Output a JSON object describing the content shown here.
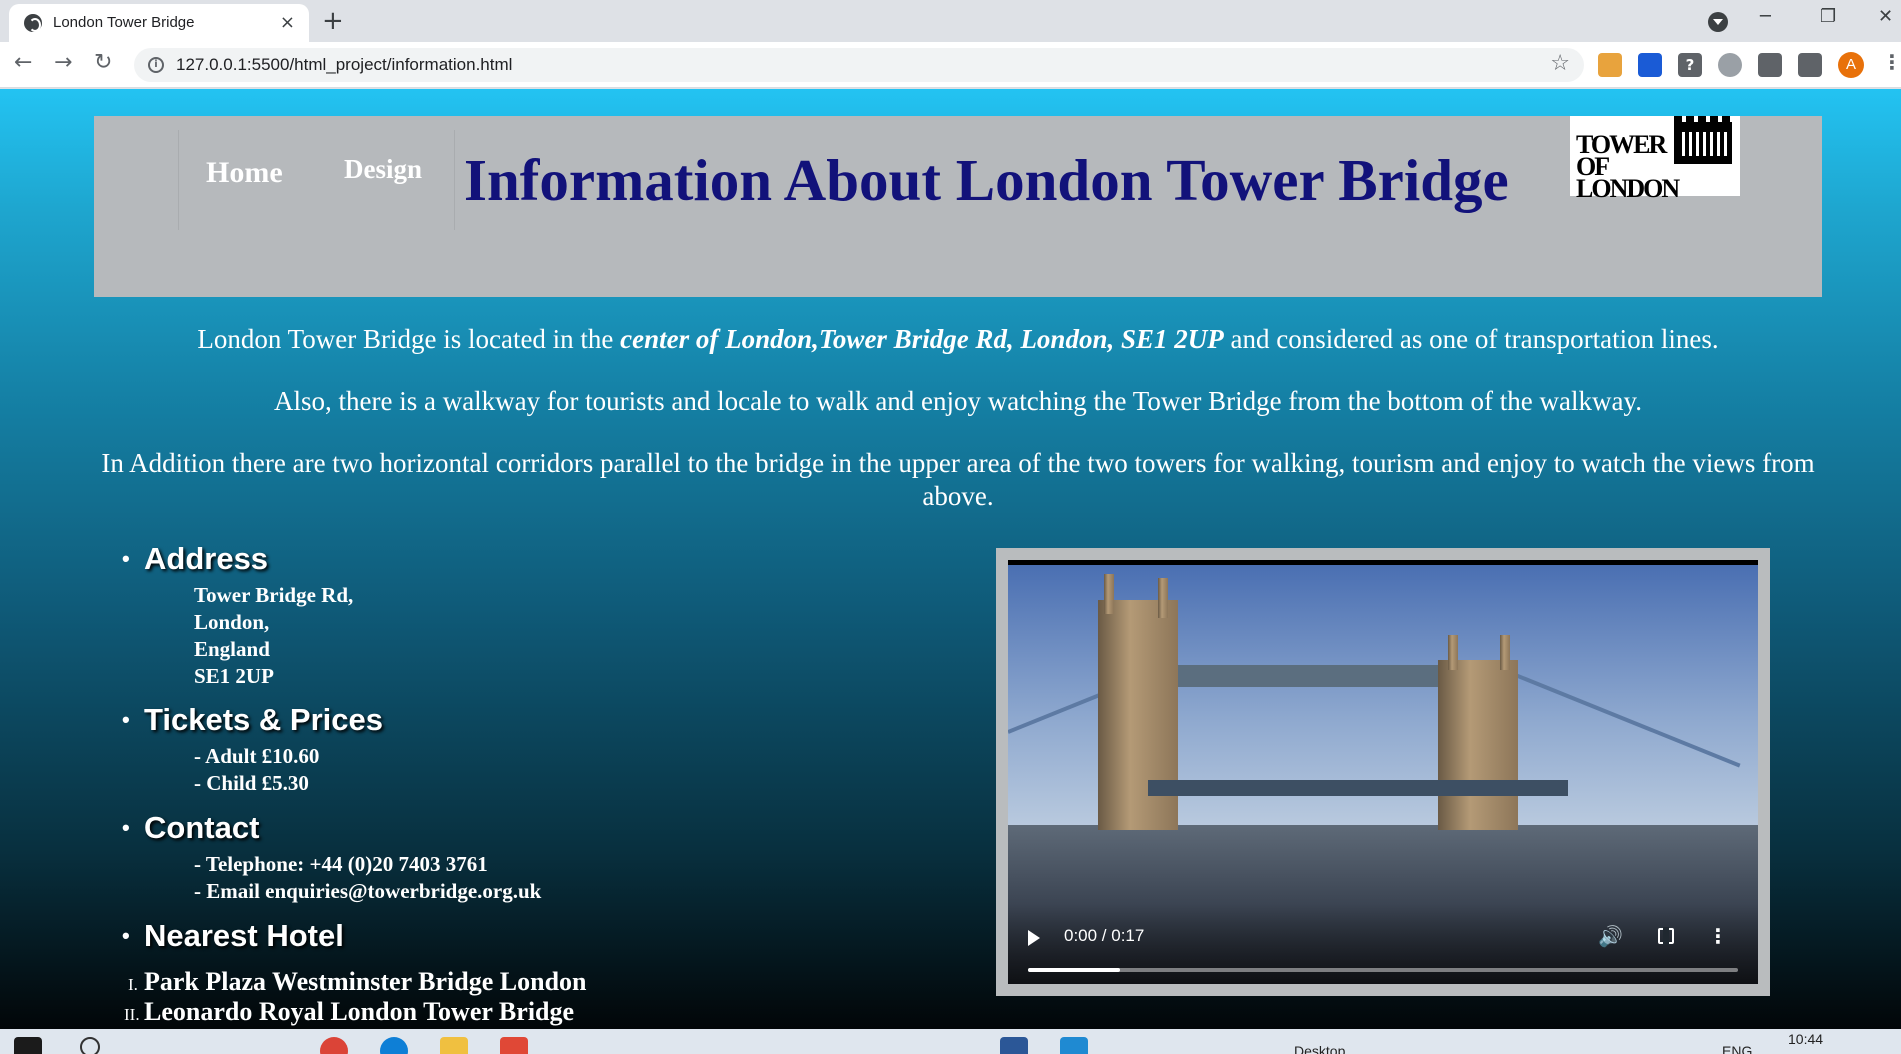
{
  "browser": {
    "tab_title": "London Tower Bridge",
    "tab_close": "×",
    "new_tab": "+",
    "url": "127.0.0.1:5500/html_project/information.html",
    "profile_initial": "A",
    "minimize": "─",
    "maximize": "❐",
    "close": "✕",
    "back": "←",
    "forward": "→",
    "reload": "↻",
    "star": "☆",
    "menu": "⋮",
    "info": "i",
    "extension_help": "?"
  },
  "nav": {
    "home": "Home",
    "design": "Design"
  },
  "header": {
    "title": "Information About London Tower Bridge",
    "logo_text": "TOWER OF LONDON"
  },
  "intro": {
    "p1_before": "London Tower Bridge is located in the ",
    "p1_emphasis": "center of London,Tower Bridge Rd, London, SE1 2UP",
    "p1_after": " and considered as one of transportation lines.",
    "p2": "Also, there is a walkway for tourists and locale to walk and enjoy watching the Tower Bridge from the bottom of the walkway.",
    "p3": "In Addition there are two horizontal corridors parallel to the bridge in the upper area of the two towers for walking, tourism and enjoy to watch the views from above."
  },
  "sections": {
    "address": {
      "heading": "Address",
      "lines": [
        "Tower Bridge Rd,",
        "London,",
        "England",
        "SE1 2UP"
      ]
    },
    "tickets": {
      "heading": "Tickets & Prices",
      "lines": [
        "- Adult £10.60",
        "- Child £5.30"
      ]
    },
    "contact": {
      "heading": "Contact",
      "lines": [
        "- Telephone: +44 (0)20 7403 3761",
        "- Email enquiries@towerbridge.org.uk"
      ]
    },
    "hotel": {
      "heading": "Nearest Hotel",
      "numerals": [
        "I.",
        "II."
      ],
      "items": [
        "Park Plaza Westminster Bridge London",
        "Leonardo Royal London Tower Bridge"
      ]
    }
  },
  "video": {
    "time": "0:00 / 0:17",
    "buffered_fraction": 0.13,
    "volume_glyph": "🔊",
    "more_glyph": "⋮"
  },
  "taskbar": {
    "clock": "10:44",
    "desktop_label": "Desktop",
    "lang": "ENG"
  },
  "colors": {
    "title": "#12127a",
    "header_bg": "#b6b9bc",
    "page_gradient_top": "#23c3f2",
    "page_gradient_bottom": "#020608"
  }
}
